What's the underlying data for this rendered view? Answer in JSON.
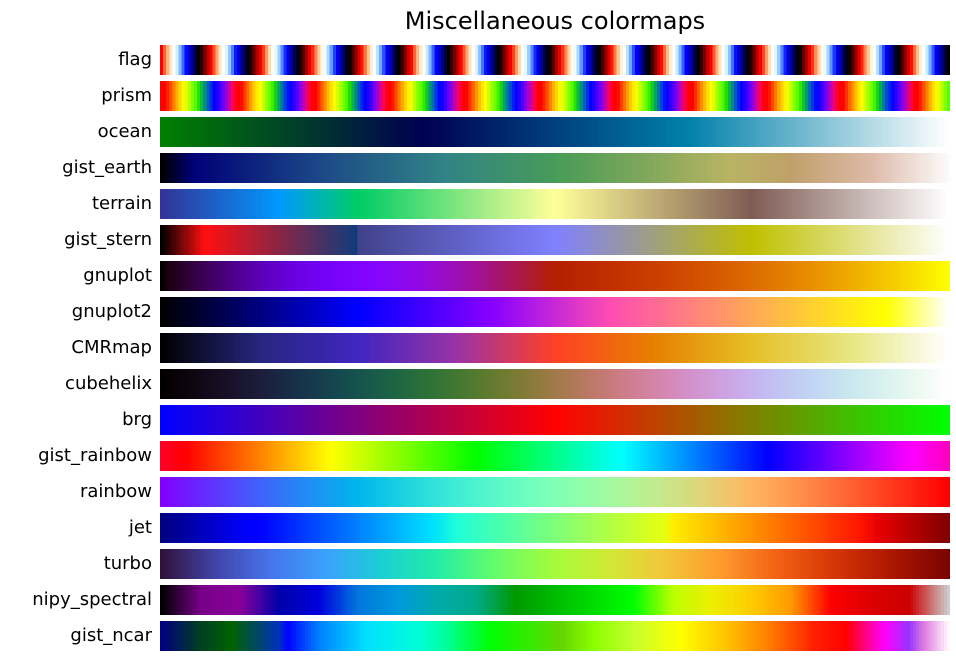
{
  "chart_data": {
    "type": "heatmap",
    "title": "Miscellaneous colormaps",
    "xlabel": "",
    "ylabel": "",
    "axes_visible": false,
    "x_range": [
      0,
      1
    ],
    "samples": 256,
    "colormaps": [
      {
        "name": "flag",
        "kind": "func",
        "func": "flag"
      },
      {
        "name": "prism",
        "kind": "func",
        "func": "prism"
      },
      {
        "name": "ocean",
        "kind": "stops",
        "stops": [
          [
            0,
            "#008000"
          ],
          [
            0.333,
            "#000051"
          ],
          [
            0.667,
            "#0080aa"
          ],
          [
            1,
            "#ffffff"
          ]
        ]
      },
      {
        "name": "gist_earth",
        "kind": "stops",
        "stops": [
          [
            0,
            "#000000"
          ],
          [
            0.04,
            "#000078"
          ],
          [
            0.2,
            "#1b4886"
          ],
          [
            0.36,
            "#318386"
          ],
          [
            0.5,
            "#479b58"
          ],
          [
            0.62,
            "#82a85a"
          ],
          [
            0.72,
            "#b8b462"
          ],
          [
            0.8,
            "#c0a06a"
          ],
          [
            0.9,
            "#dcb9a8"
          ],
          [
            1,
            "#fdfafa"
          ]
        ]
      },
      {
        "name": "terrain",
        "kind": "stops",
        "stops": [
          [
            0,
            "#333399"
          ],
          [
            0.15,
            "#0099ff"
          ],
          [
            0.25,
            "#00cc66"
          ],
          [
            0.5,
            "#ffff99"
          ],
          [
            0.75,
            "#805c54"
          ],
          [
            1,
            "#ffffff"
          ]
        ]
      },
      {
        "name": "gist_stern",
        "kind": "stops",
        "stops": [
          [
            0,
            "#000000"
          ],
          [
            0.0547,
            "#ff0f10"
          ],
          [
            0.25,
            "#0d3d7d"
          ],
          [
            0.2501,
            "#40428a"
          ],
          [
            0.5,
            "#8080ff"
          ],
          [
            0.75,
            "#bfbf00"
          ],
          [
            1,
            "#ffffff"
          ]
        ]
      },
      {
        "name": "gnuplot",
        "kind": "func",
        "func": "gnuplot"
      },
      {
        "name": "gnuplot2",
        "kind": "func",
        "func": "gnuplot2"
      },
      {
        "name": "CMRmap",
        "kind": "stops",
        "stops": [
          [
            0,
            "#000000"
          ],
          [
            0.125,
            "#262680"
          ],
          [
            0.25,
            "#4026bf"
          ],
          [
            0.375,
            "#9933a6"
          ],
          [
            0.5,
            "#ff4026"
          ],
          [
            0.625,
            "#e68000"
          ],
          [
            0.75,
            "#e6bf26"
          ],
          [
            0.875,
            "#e6e680"
          ],
          [
            1,
            "#ffffff"
          ]
        ]
      },
      {
        "name": "cubehelix",
        "kind": "func",
        "func": "cubehelix"
      },
      {
        "name": "brg",
        "kind": "stops",
        "stops": [
          [
            0,
            "#0000ff"
          ],
          [
            0.5,
            "#ff0000"
          ],
          [
            1,
            "#00ff00"
          ]
        ]
      },
      {
        "name": "gist_rainbow",
        "kind": "func",
        "func": "gist_rainbow"
      },
      {
        "name": "rainbow",
        "kind": "func",
        "func": "rainbow"
      },
      {
        "name": "jet",
        "kind": "stops",
        "stops": [
          [
            0,
            "#000080"
          ],
          [
            0.11,
            "#0000ff"
          ],
          [
            0.125,
            "#0000ff"
          ],
          [
            0.34,
            "#00ddff"
          ],
          [
            0.35,
            "#00e5f8"
          ],
          [
            0.375,
            "#20ffd7"
          ],
          [
            0.64,
            "#e7ff0f"
          ],
          [
            0.65,
            "#ffed00"
          ],
          [
            0.89,
            "#ff1300"
          ],
          [
            0.91,
            "#e80000"
          ],
          [
            1,
            "#800000"
          ]
        ]
      },
      {
        "name": "turbo",
        "kind": "stops",
        "stops": [
          [
            0,
            "#30123b"
          ],
          [
            0.07,
            "#4145ab"
          ],
          [
            0.14,
            "#4675ed"
          ],
          [
            0.21,
            "#39a2fc"
          ],
          [
            0.28,
            "#1bcfd4"
          ],
          [
            0.35,
            "#24eca6"
          ],
          [
            0.42,
            "#61fc6c"
          ],
          [
            0.5,
            "#a4fc3b"
          ],
          [
            0.57,
            "#d1e834"
          ],
          [
            0.64,
            "#f3c63a"
          ],
          [
            0.71,
            "#fe9b2d"
          ],
          [
            0.78,
            "#f36315"
          ],
          [
            0.85,
            "#d93806"
          ],
          [
            0.92,
            "#b11901"
          ],
          [
            1,
            "#7a0402"
          ]
        ]
      },
      {
        "name": "nipy_spectral",
        "kind": "stops",
        "stops": [
          [
            0,
            "#000000"
          ],
          [
            0.05,
            "#770088"
          ],
          [
            0.1,
            "#880099"
          ],
          [
            0.15,
            "#0000aa"
          ],
          [
            0.2,
            "#0000dd"
          ],
          [
            0.25,
            "#0077dd"
          ],
          [
            0.3,
            "#0099dd"
          ],
          [
            0.35,
            "#00aaaa"
          ],
          [
            0.4,
            "#00aa88"
          ],
          [
            0.45,
            "#009900"
          ],
          [
            0.5,
            "#00bb00"
          ],
          [
            0.55,
            "#00dd00"
          ],
          [
            0.6,
            "#00ff00"
          ],
          [
            0.65,
            "#bbff00"
          ],
          [
            0.7,
            "#eeee00"
          ],
          [
            0.75,
            "#ffcc00"
          ],
          [
            0.8,
            "#ff9900"
          ],
          [
            0.85,
            "#ff0000"
          ],
          [
            0.9,
            "#dd0000"
          ],
          [
            0.95,
            "#cc0000"
          ],
          [
            1,
            "#cccccc"
          ]
        ]
      },
      {
        "name": "gist_ncar",
        "kind": "stops",
        "stops": [
          [
            0,
            "#000080"
          ],
          [
            0.05,
            "#004020"
          ],
          [
            0.09,
            "#006200"
          ],
          [
            0.15,
            "#0030c0"
          ],
          [
            0.16,
            "#0000ff"
          ],
          [
            0.2,
            "#0080ff"
          ],
          [
            0.26,
            "#00e0ff"
          ],
          [
            0.33,
            "#00ffd4"
          ],
          [
            0.36,
            "#00ff9c"
          ],
          [
            0.42,
            "#00ff00"
          ],
          [
            0.51,
            "#67d600"
          ],
          [
            0.55,
            "#8cff00"
          ],
          [
            0.6,
            "#c6ff2c"
          ],
          [
            0.66,
            "#ffff00"
          ],
          [
            0.72,
            "#ffc000"
          ],
          [
            0.77,
            "#ff8000"
          ],
          [
            0.83,
            "#ff2000"
          ],
          [
            0.87,
            "#ff0000"
          ],
          [
            0.9,
            "#ff00a0"
          ],
          [
            0.92,
            "#ff00ff"
          ],
          [
            0.95,
            "#9933ff"
          ],
          [
            0.97,
            "#e080e0"
          ],
          [
            1,
            "#fff8ff"
          ]
        ]
      }
    ]
  }
}
